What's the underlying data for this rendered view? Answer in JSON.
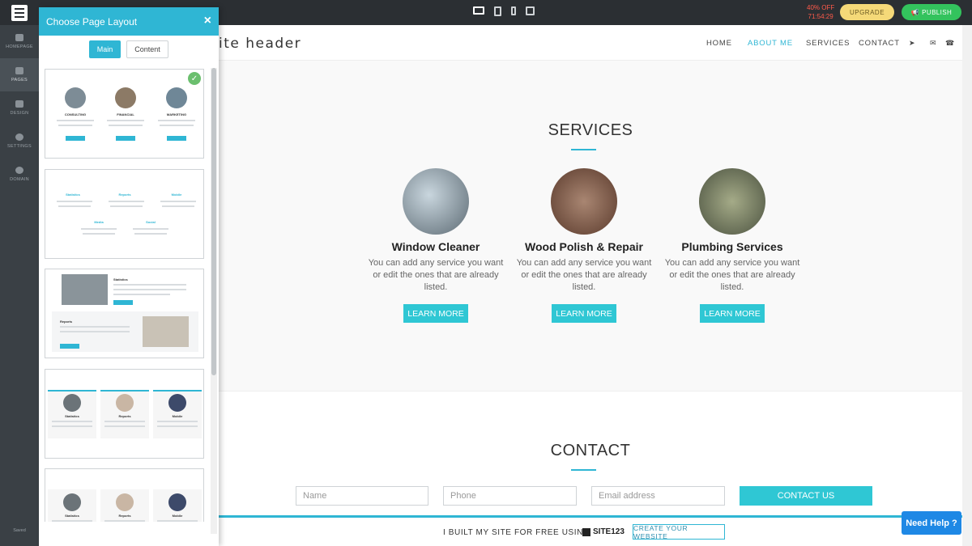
{
  "topbar": {
    "offer_line1": "40% OFF",
    "offer_line2": "71:54:29",
    "upgrade_label": "UPGRADE",
    "publish_label": "PUBLISH",
    "devices": [
      "desktop-icon",
      "tablet-icon",
      "mobile-icon",
      "external-link-icon"
    ]
  },
  "rail": {
    "items": [
      {
        "label": "HOMEPAGE",
        "icon": "home-icon"
      },
      {
        "label": "PAGES",
        "icon": "pages-icon"
      },
      {
        "label": "DESIGN",
        "icon": "brush-icon"
      },
      {
        "label": "SETTINGS",
        "icon": "gear-icon"
      },
      {
        "label": "DOMAIN",
        "icon": "globe-icon"
      }
    ],
    "saved": "Saved"
  },
  "panel": {
    "title": "Choose Page Layout",
    "close": "×",
    "tabs": [
      {
        "label": "Main"
      },
      {
        "label": "Content"
      }
    ],
    "thumb1": {
      "captions": [
        "CONSULTING",
        "FINANCIAL",
        "MARKETING"
      ],
      "button": "LEARN MORE"
    },
    "thumb2": {
      "labels": [
        "Statistics",
        "Reports",
        "Mobile",
        "Media",
        "Social"
      ]
    },
    "thumb3": {
      "labels": [
        "Statistics",
        "Reports"
      ],
      "button": "LEARN MORE"
    },
    "thumb4": {
      "labels": [
        "Statistics",
        "Reports",
        "Mobile"
      ]
    },
    "thumb5": {
      "labels": [
        "Statistics",
        "Reports",
        "Mobile"
      ]
    }
  },
  "site": {
    "title": "ite header",
    "nav": [
      "HOME",
      "ABOUT ME",
      "SERVICES",
      "CONTACT"
    ],
    "nav_active": "ABOUT ME",
    "services": {
      "title": "SERVICES",
      "items": [
        {
          "name": "Window Cleaner",
          "desc": "You can add any service you want or edit the ones that are already listed.",
          "button": "LEARN MORE"
        },
        {
          "name": "Wood Polish & Repair",
          "desc": "You can add any service you want or edit the ones that are already listed.",
          "button": "LEARN MORE"
        },
        {
          "name": "Plumbing Services",
          "desc": "You can add any service you want or edit the ones that are already listed.",
          "button": "LEARN MORE"
        }
      ]
    },
    "contact": {
      "title": "CONTACT",
      "name_placeholder": "Name",
      "phone_placeholder": "Phone",
      "email_placeholder": "Email address",
      "button": "CONTACT US"
    }
  },
  "footer": {
    "text": "I BUILT MY SITE FOR FREE USING",
    "brand": "SITE123",
    "button": "CREATE YOUR WEBSITE"
  },
  "help": "Need Help ?",
  "colors": {
    "accent": "#2fb6d4",
    "publish": "#33c35d",
    "upgrade": "#f5d978",
    "help": "#1e88e5"
  }
}
